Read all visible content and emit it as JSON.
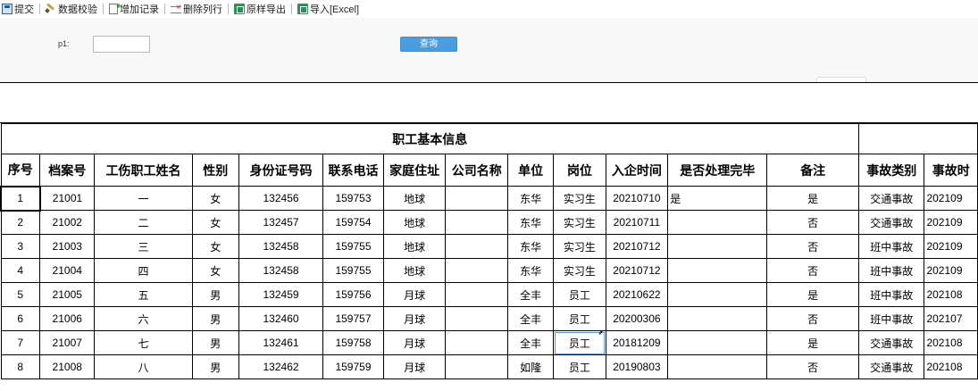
{
  "toolbar": {
    "items": [
      {
        "label": "提交",
        "icon": "submit-icon"
      },
      {
        "label": "数据校验",
        "icon": "check-icon"
      },
      {
        "label": "增加记录",
        "icon": "add-record-icon"
      },
      {
        "label": "删除列行",
        "icon": "delete-row-icon"
      },
      {
        "label": "原样导出",
        "icon": "excel-export-icon"
      },
      {
        "label": "导入[Excel]",
        "icon": "excel-import-icon"
      }
    ]
  },
  "query": {
    "p1_label": "p1:",
    "p1_value": "",
    "search_label": "查询"
  },
  "report": {
    "title": "职工基本信息",
    "headers": [
      "序号",
      "档案号",
      "工伤职工姓名",
      "性别",
      "身份证号码",
      "联系电话",
      "家庭住址",
      "公司名称",
      "单位",
      "岗位",
      "入企时间",
      "是否处理完毕",
      "备注",
      "事故类别",
      "事故时"
    ],
    "rows": [
      [
        "1",
        "21001",
        "一",
        "女",
        "132456",
        "159753",
        "地球",
        "",
        "东华",
        "实习生",
        "20210710",
        "是",
        "是",
        "交通事故",
        "202109"
      ],
      [
        "2",
        "21002",
        "二",
        "女",
        "132457",
        "159754",
        "地球",
        "",
        "东华",
        "实习生",
        "20210711",
        "",
        "否",
        "交通事故",
        "202109"
      ],
      [
        "3",
        "21003",
        "三",
        "女",
        "132458",
        "159755",
        "地球",
        "",
        "东华",
        "实习生",
        "20210712",
        "",
        "否",
        "班中事故",
        "202109"
      ],
      [
        "4",
        "21004",
        "四",
        "女",
        "132458",
        "159755",
        "地球",
        "",
        "东华",
        "实习生",
        "20210712",
        "",
        "否",
        "班中事故",
        "202109"
      ],
      [
        "5",
        "21005",
        "五",
        "男",
        "132459",
        "159756",
        "月球",
        "",
        "全丰",
        "员工",
        "20210622",
        "",
        "是",
        "班中事故",
        "202108"
      ],
      [
        "6",
        "21006",
        "六",
        "男",
        "132460",
        "159757",
        "月球",
        "",
        "全丰",
        "员工",
        "20200306",
        "",
        "否",
        "班中事故",
        "202107"
      ],
      [
        "7",
        "21007",
        "七",
        "男",
        "132461",
        "159758",
        "月球",
        "",
        "全丰",
        "员工",
        "20181209",
        "",
        "是",
        "交通事故",
        "202108"
      ],
      [
        "8",
        "21008",
        "八",
        "男",
        "132462",
        "159759",
        "月球",
        "",
        "如隆",
        "员工",
        "20190803",
        "",
        "否",
        "交通事故",
        "202108"
      ]
    ]
  }
}
